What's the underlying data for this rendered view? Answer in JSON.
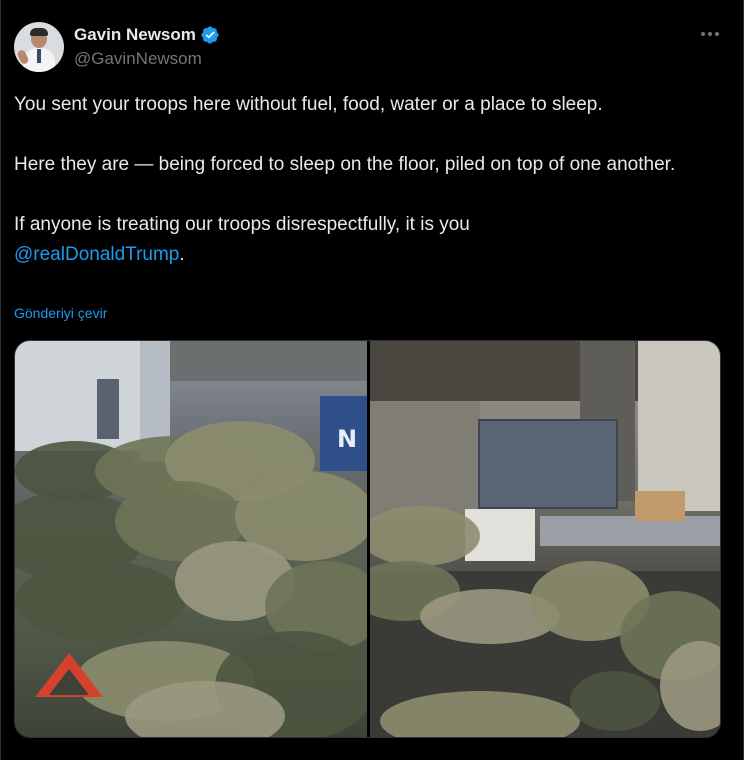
{
  "post": {
    "author": {
      "display_name": "Gavin Newsom",
      "handle": "@GavinNewsom",
      "verified": true,
      "avatar_icon": "user-avatar"
    },
    "more_icon": "more-options-icon",
    "text": {
      "para1": "You sent your troops here without fuel, food, water or a place to sleep.",
      "para2": "Here they are — being forced to sleep on the floor, piled on top of one another.",
      "para3_prefix": "If anyone is treating our troops disrespectfully, it is you",
      "mention": "@realDonaldTrump",
      "para3_suffix": "."
    },
    "translate_label": "Gönderiyi çevir",
    "media": {
      "count": 2,
      "left_photo_sign": "N"
    }
  },
  "colors": {
    "background": "#000000",
    "text": "#e7e9ea",
    "secondary": "#71767b",
    "accent": "#1d9bf0",
    "border": "#2f3336"
  }
}
